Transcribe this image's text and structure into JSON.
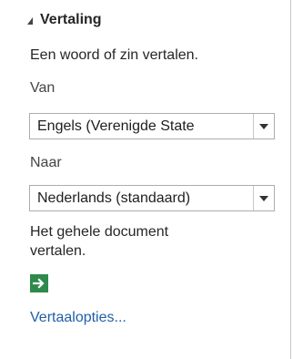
{
  "section": {
    "title": "Vertaling"
  },
  "intro_text": "Een woord of zin vertalen.",
  "from": {
    "label": "Van",
    "selected": "Engels (Verenigde State"
  },
  "to": {
    "label": "Naar",
    "selected": "Nederlands (standaard)"
  },
  "document": {
    "line1": "Het gehele document",
    "line2": "vertalen.",
    "go_icon": "arrow-right-icon",
    "go_color": "#2e8a4a"
  },
  "options_link": "Vertaalopties..."
}
